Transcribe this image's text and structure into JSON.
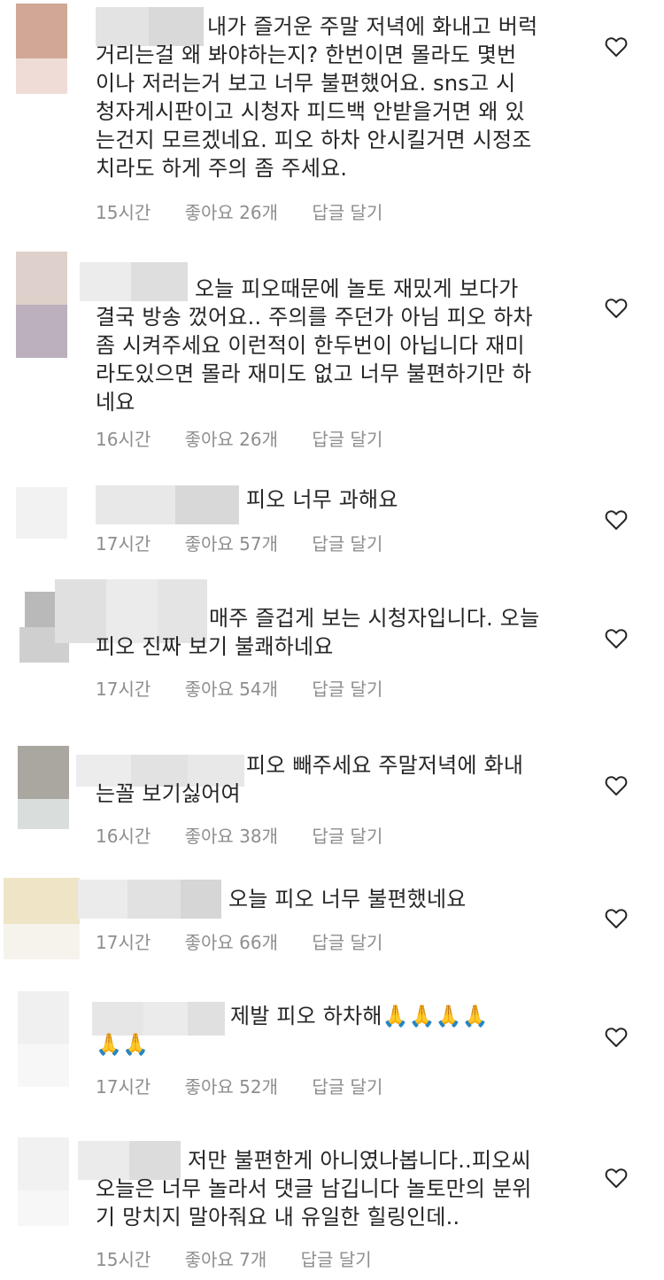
{
  "colors": {
    "text": "#262626",
    "meta": "#8e8e8e",
    "background": "#ffffff",
    "heart": "#262626"
  },
  "comments": [
    {
      "text": "내가 즐거운 주말 저녁에 화내고 버럭\n거리는걸 왜 봐야하는지? 한번이면 몰라도 몇번\n이나 저러는거 보고 너무 불편했어요. sns고 시\n청자게시판이고 시청자 피드백 안받을거면 왜 있\n는건지 모르겠네요. 피오 하차 안시킬거면 시정조\n치라도 하게 주의 좀 주세요.",
      "time": "15시간",
      "likes": "좋아요 26개",
      "reply": "답글 달기"
    },
    {
      "text": "오늘 피오때문에 놀토 재밌게 보다가\n결국 방송 껐어요.. 주의를 주던가 아님 피오 하차\n좀 시켜주세요 이런적이 한두번이 아닙니다 재미\n라도있으면 몰라 재미도 없고 너무 불편하기만 하\n네요",
      "time": "16시간",
      "likes": "좋아요 26개",
      "reply": "답글 달기"
    },
    {
      "text": "피오 너무 과해요",
      "time": "17시간",
      "likes": "좋아요 57개",
      "reply": "답글 달기"
    },
    {
      "text": "매주 즐겁게 보는 시청자입니다. 오늘\n피오 진짜 보기 불쾌하네요",
      "time": "17시간",
      "likes": "좋아요 54개",
      "reply": "답글 달기"
    },
    {
      "text": "피오 빼주세요 주말저녁에 화내\n는꼴 보기싫어여",
      "time": "16시간",
      "likes": "좋아요 38개",
      "reply": "답글 달기"
    },
    {
      "text": "오늘 피오 너무 불편했네요",
      "time": "17시간",
      "likes": "좋아요 66개",
      "reply": "답글 달기"
    },
    {
      "text": "제발 피오 하차해🙏🙏🙏🙏\n🙏🙏",
      "time": "17시간",
      "likes": "좋아요 52개",
      "reply": "답글 달기"
    },
    {
      "text": "저만 불편한게 아니였나봅니다..피오씨\n오늘은 너무 놀라서 댓글 남깁니다 놀토만의 분위\n기 망치지 말아줘요 내 유일한 힐링인데..",
      "time": "15시간",
      "likes": "좋아요 7개",
      "reply": "답글 달기"
    }
  ],
  "icons": {
    "like": "heart-outline-icon"
  }
}
